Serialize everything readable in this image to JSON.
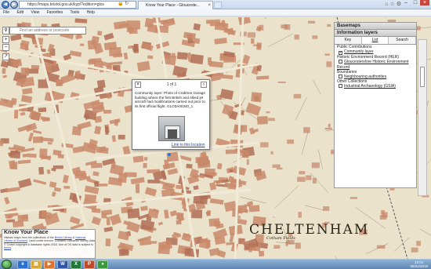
{
  "browser": {
    "url": "https://maps.bristol.gov.uk/kyp/?edition=glos",
    "tab_title": "Know Your Place - Glouceste...",
    "menu": [
      "File",
      "Edit",
      "View",
      "Favorites",
      "Tools",
      "Help"
    ]
  },
  "map": {
    "search_placeholder": "Find an address or postcode",
    "place_label": "CHELTENHAM",
    "place_sublabel": "Cotham Fields"
  },
  "popup": {
    "count": "1 of 1",
    "description": "Community layer: Photo of Crabtree Garage building where the first British and Allied jet aircraft had modifications carried out prior to its first official flight. GLO3A00340_1",
    "link": "Link to this location"
  },
  "panel": {
    "basemaps": "Basemaps",
    "info_layers": "Information layers",
    "tabs": [
      "Key",
      "List",
      "Search"
    ],
    "items": [
      {
        "label": "Public Contributions",
        "type": "header"
      },
      {
        "label": "Community layer",
        "type": "check",
        "checked": true
      },
      {
        "label": "Historic Environment Record (HER)",
        "type": "header"
      },
      {
        "label": "Gloucestershire Historic Environment",
        "type": "check",
        "checked": false
      },
      {
        "label": "Record",
        "type": "link"
      },
      {
        "label": "Boundaries",
        "type": "header"
      },
      {
        "label": "Neighbouring authorities",
        "type": "check",
        "checked": false
      },
      {
        "label": "Other Collections",
        "type": "header"
      },
      {
        "label": "Industrial Archaeology (GSIA)",
        "type": "check",
        "checked": false
      }
    ]
  },
  "kyp": {
    "title": "Know Your Place",
    "text_parts": [
      "Historic maps from the collections of the ",
      "British Library",
      " & ",
      "National Library of Scotland",
      ". Used under licence. Contains Ordnance Survey data © Crown copyright & database rights 2018. Use of OS data is subject to ",
      "terms",
      "."
    ]
  },
  "taskbar": {
    "time": "12:01",
    "date": "06/01/2018",
    "apps": [
      "ie",
      "explorer",
      "media",
      "word",
      "excel",
      "powerpoint",
      "chrome"
    ]
  },
  "colors": {
    "map_bg": "#e9dfc8",
    "block_red": "#c98a6a",
    "panel_header": "#c9c9c9",
    "link_blue": "#1a44a8"
  }
}
